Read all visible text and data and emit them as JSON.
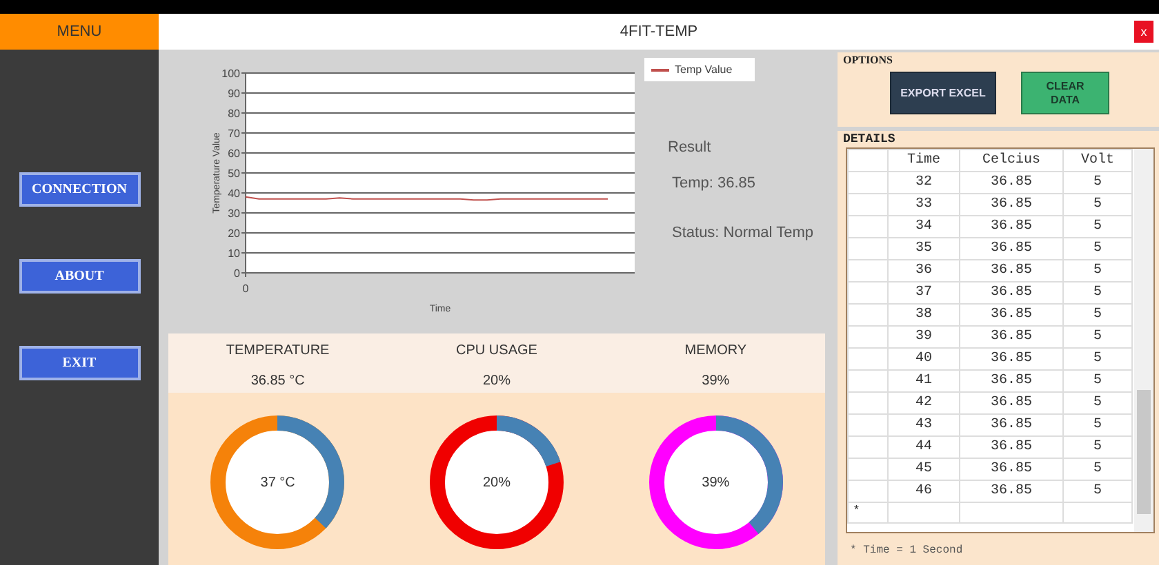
{
  "window": {
    "menu_label": "MENU",
    "title": "4FIT-TEMP",
    "close": "x"
  },
  "sidebar": {
    "buttons": [
      "CONNECTION",
      "ABOUT",
      "EXIT"
    ]
  },
  "chart": {
    "chart_data": {
      "type": "line",
      "xlabel": "Time",
      "ylabel": "Temperature Value",
      "series": [
        {
          "name": "Temp Value",
          "color": "#c0504d",
          "values": [
            38,
            37,
            37,
            37,
            37,
            37,
            37,
            37.5,
            37,
            37,
            37,
            37,
            37,
            37,
            37,
            37,
            37,
            36.5,
            36.5,
            37,
            37,
            37,
            37,
            37,
            37,
            37,
            37,
            37
          ]
        }
      ],
      "grid": true,
      "ylim": [
        0,
        100
      ],
      "yticks": [
        0,
        10,
        20,
        30,
        40,
        50,
        60,
        70,
        80,
        90,
        100
      ],
      "annotations": [
        {
          "text": "0"
        }
      ]
    }
  },
  "result": {
    "heading": "Result",
    "temp": "Temp: 36.85",
    "status": "Status: Normal Temp"
  },
  "stats": [
    {
      "label": "TEMPERATURE",
      "value": "36.85 °C",
      "gauge_text": "37 °C",
      "color": "#f5820a"
    },
    {
      "label": "CPU USAGE",
      "value": "20%",
      "gauge_text": "20%",
      "color": "#f00000"
    },
    {
      "label": "MEMORY",
      "value": "39%",
      "gauge_text": "39%",
      "color": "#ff00ff"
    }
  ],
  "options": {
    "title": "OPTIONS",
    "buttons": [
      {
        "label": "EXPORT EXCEL",
        "kind": "export"
      },
      {
        "label": "CLEAR DATA",
        "kind": "clear"
      }
    ]
  },
  "details": {
    "title": "DETAILS",
    "columns": [
      "Time",
      "Celcius",
      "Volt"
    ],
    "rows": [
      [
        "32",
        "36.85",
        "5"
      ],
      [
        "33",
        "36.85",
        "5"
      ],
      [
        "34",
        "36.85",
        "5"
      ],
      [
        "35",
        "36.85",
        "5"
      ],
      [
        "36",
        "36.85",
        "5"
      ],
      [
        "37",
        "36.85",
        "5"
      ],
      [
        "38",
        "36.85",
        "5"
      ],
      [
        "39",
        "36.85",
        "5"
      ],
      [
        "40",
        "36.85",
        "5"
      ],
      [
        "41",
        "36.85",
        "5"
      ],
      [
        "42",
        "36.85",
        "5"
      ],
      [
        "43",
        "36.85",
        "5"
      ],
      [
        "44",
        "36.85",
        "5"
      ],
      [
        "45",
        "36.85",
        "5"
      ],
      [
        "46",
        "36.85",
        "5"
      ]
    ],
    "new_row_marker": "*",
    "note": "* Time = 1 Second"
  }
}
